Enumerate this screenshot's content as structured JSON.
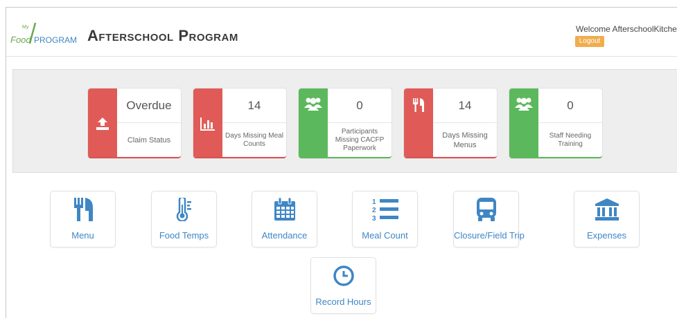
{
  "header": {
    "logo_text": "FoodPROGRAM",
    "logo_small": "My",
    "app_title": "Afterschool Program",
    "welcome": "Welcome AfterschoolKitchen",
    "logout_label": "Logout"
  },
  "status_cards": [
    {
      "value": "Overdue",
      "label": "Claim Status",
      "color": "#e05b57",
      "icon": "upload-icon"
    },
    {
      "value": "14",
      "label": "Days Missing Meal Counts",
      "color": "#e05b57",
      "icon": "bar-chart-icon"
    },
    {
      "value": "0",
      "label": "Participants Missing CACFP Paperwork",
      "color": "#5cb85c",
      "icon": "users-icon"
    },
    {
      "value": "14",
      "label": "Days Missing Menus",
      "color": "#e05b57",
      "icon": "fork-knife-icon"
    },
    {
      "value": "0",
      "label": "Staff Needing Training",
      "color": "#5cb85c",
      "icon": "users-icon"
    }
  ],
  "nav_tiles": [
    {
      "label": "Menu",
      "icon": "fork-knife-icon"
    },
    {
      "label": "Food Temps",
      "icon": "thermometer-icon"
    },
    {
      "label": "Attendance",
      "icon": "calendar-icon"
    },
    {
      "label": "Meal Count",
      "icon": "numbered-list-icon"
    },
    {
      "label": "Closure/Field Trip",
      "icon": "bus-icon"
    },
    {
      "label": "Expenses",
      "icon": "bank-icon"
    },
    {
      "label": "Record Hours",
      "icon": "clock-icon"
    }
  ],
  "colors": {
    "accent_blue": "#3f86c5",
    "danger": "#e05b57",
    "success": "#5cb85c",
    "warning": "#f0ad4e"
  }
}
